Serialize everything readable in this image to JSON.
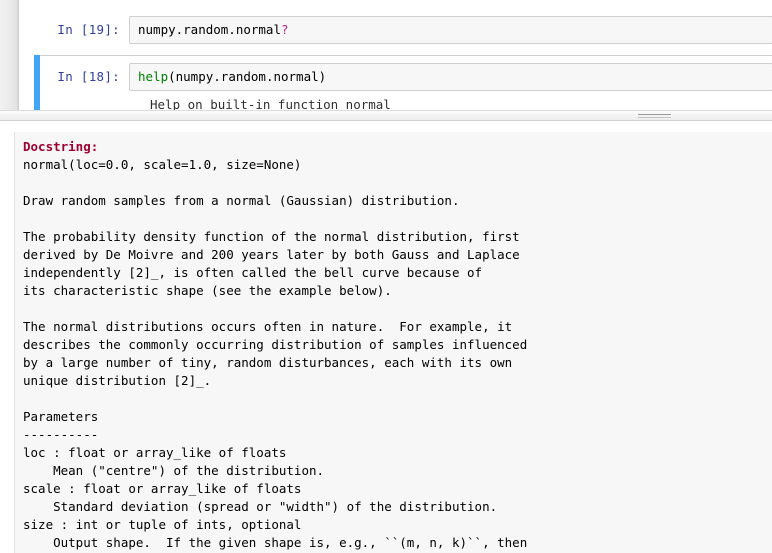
{
  "notebook": {
    "cells": [
      {
        "prompt": "In [19]:",
        "code_text": "numpy.random.normal",
        "code_suffix": "?",
        "selected": false
      },
      {
        "prompt": "In [18]:",
        "code_keyword": "help",
        "code_text": "(numpy.random.normal)",
        "output_partial": "Help on built-in function normal",
        "selected": true
      }
    ],
    "selection_bar_color": "#42a5f5"
  },
  "splitter": {
    "grip_icon": "resize-grip-icon"
  },
  "pager": {
    "heading": "Docstring:",
    "heading_color": "#a00030",
    "body": "normal(loc=0.0, scale=1.0, size=None)\n\nDraw random samples from a normal (Gaussian) distribution.\n\nThe probability density function of the normal distribution, first\nderived by De Moivre and 200 years later by both Gauss and Laplace\nindependently [2]_, is often called the bell curve because of\nits characteristic shape (see the example below).\n\nThe normal distributions occurs often in nature.  For example, it\ndescribes the commonly occurring distribution of samples influenced\nby a large number of tiny, random disturbances, each with its own\nunique distribution [2]_.\n\nParameters\n----------\nloc : float or array_like of floats\n    Mean (\"centre\") of the distribution.\nscale : float or array_like of floats\n    Standard deviation (spread or \"width\") of the distribution.\nsize : int or tuple of ints, optional\n    Output shape.  If the given shape is, e.g., ``(m, n, k)``, then"
  }
}
